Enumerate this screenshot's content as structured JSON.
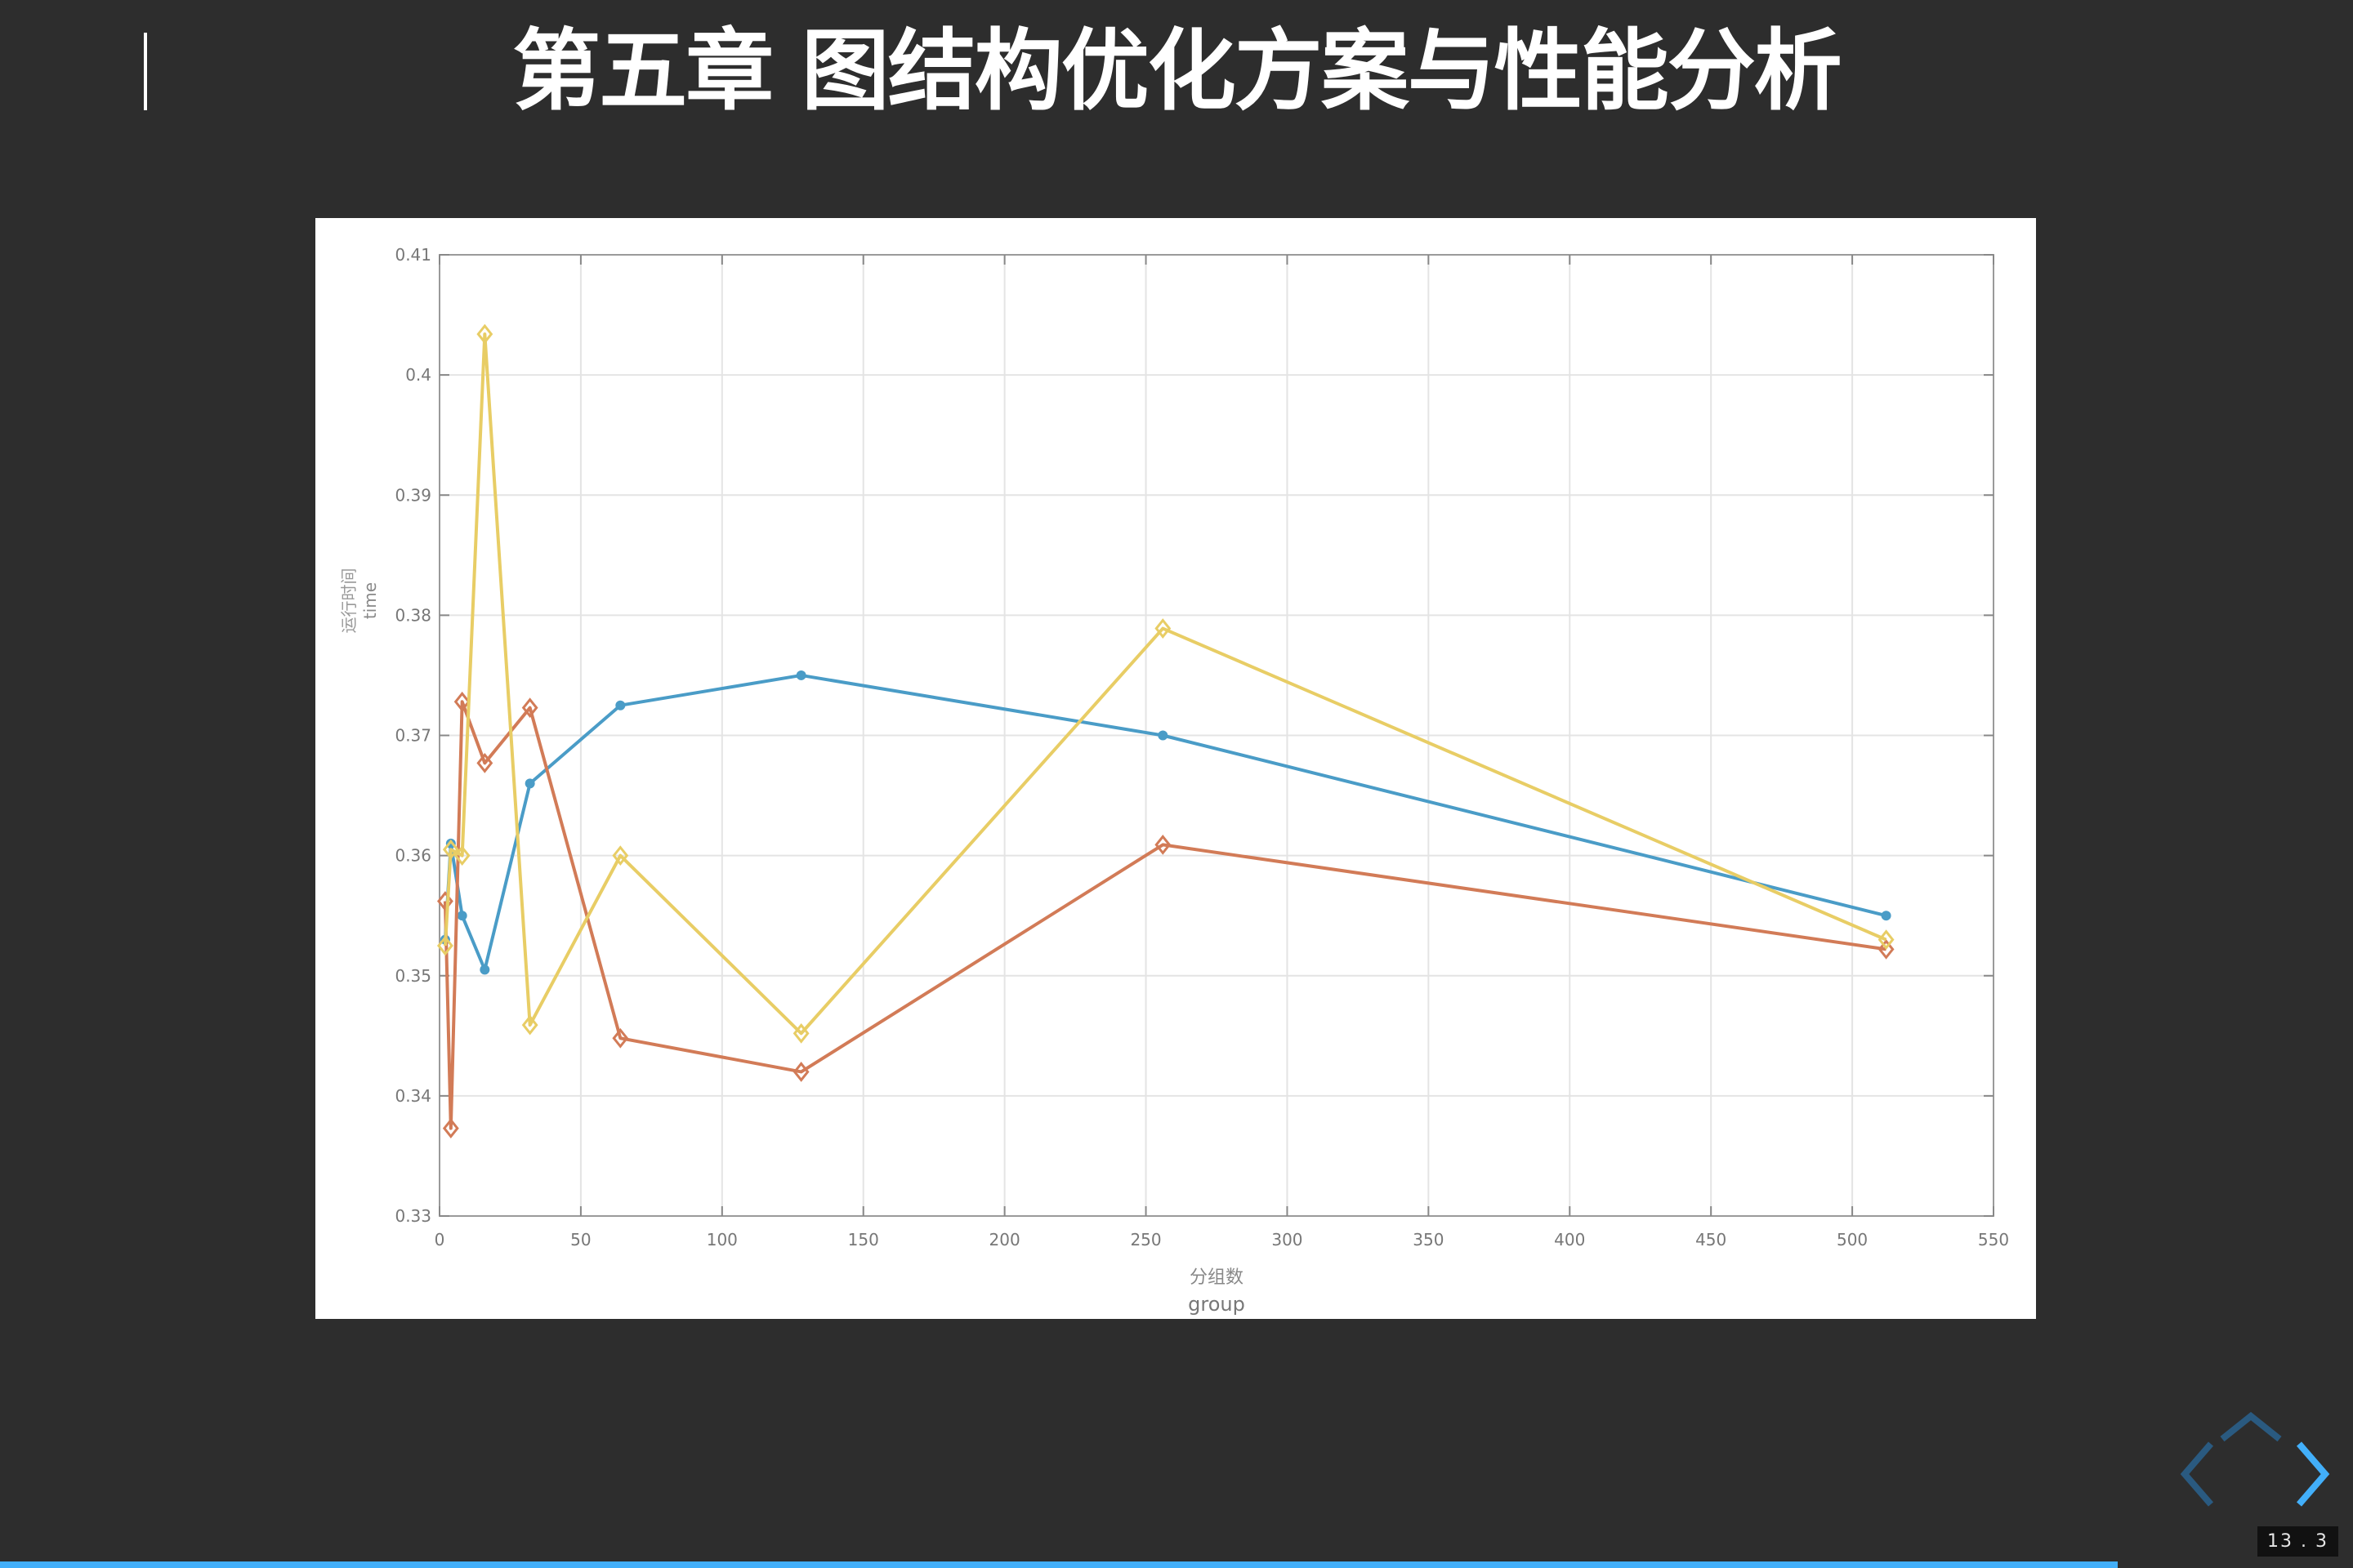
{
  "slide": {
    "title": "第五章 图结构优化方案与性能分析",
    "page_indicator": "13 . 3",
    "progress": 0.9
  },
  "colors": {
    "background": "#2d2d2d",
    "accent": "#42affa",
    "series_blue": "#4a9cc7",
    "series_orange": "#d27b57",
    "series_yellow": "#e8cd65"
  },
  "navigation": {
    "up_icon": "chevron-up-icon",
    "left_icon": "chevron-left-icon",
    "right_icon": "chevron-right-icon"
  },
  "chart_data": {
    "type": "line",
    "title": "",
    "xlabel": "分组数",
    "xlabel_en": "group",
    "ylabel": "运行时间",
    "ylabel_en": "time",
    "xlim": [
      0,
      550
    ],
    "ylim": [
      0.33,
      0.41
    ],
    "xticks": [
      0,
      50,
      100,
      150,
      200,
      250,
      300,
      350,
      400,
      450,
      500,
      550
    ],
    "yticks": [
      0.33,
      0.34,
      0.35,
      0.36,
      0.37,
      0.38,
      0.39,
      0.4,
      0.41
    ],
    "ytick_labels": [
      "0.33",
      "0.34",
      "0.35",
      "0.36",
      "0.37",
      "0.38",
      "0.39",
      "0.4",
      "0.41"
    ],
    "grid": true,
    "series": [
      {
        "color": "#4a9cc7",
        "marker": "dot",
        "x": [
          2,
          4,
          8,
          16,
          32,
          64,
          128,
          256,
          512
        ],
        "values": [
          0.353,
          0.361,
          0.355,
          0.3505,
          0.366,
          0.3725,
          0.375,
          0.37,
          0.355
        ]
      },
      {
        "color": "#d27b57",
        "marker": "diamond",
        "x": [
          2,
          4,
          8,
          16,
          32,
          64,
          128,
          256,
          512
        ],
        "values": [
          0.3562,
          0.3373,
          0.3728,
          0.3677,
          0.3723,
          0.3448,
          0.342,
          0.3609,
          0.3522
        ]
      },
      {
        "color": "#e8cd65",
        "marker": "diamond",
        "x": [
          2,
          4,
          8,
          16,
          32,
          64,
          128,
          256,
          512
        ],
        "values": [
          0.3525,
          0.3605,
          0.36,
          0.4034,
          0.3459,
          0.36,
          0.3452,
          0.3789,
          0.353
        ]
      }
    ]
  }
}
